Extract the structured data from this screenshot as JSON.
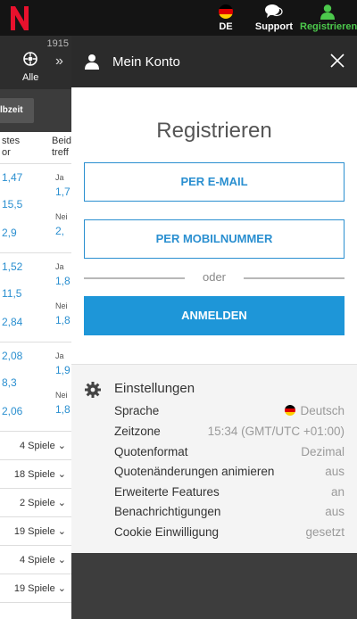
{
  "header": {
    "language_label": "DE",
    "support_label": "Support",
    "register_label": "Registrieren"
  },
  "sport_strip": {
    "count": "1915",
    "label": "Alle"
  },
  "left_list": {
    "halbzeit": "lbzeit",
    "col1_header": [
      "stes",
      "or"
    ],
    "col2_header": [
      "Beid",
      "treff"
    ],
    "blocks": [
      {
        "odds": [
          "1,47",
          "15,5",
          "2,9"
        ],
        "right": [
          {
            "label": "Ja",
            "odd": "1,7"
          },
          {
            "label": "Nei",
            "odd": "2,"
          }
        ]
      },
      {
        "odds": [
          "1,52",
          "11,5",
          "2,84"
        ],
        "right": [
          {
            "label": "Ja",
            "odd": "1,8"
          },
          {
            "label": "Nei",
            "odd": "1,8"
          }
        ]
      },
      {
        "odds": [
          "2,08",
          "8,3",
          "2,06"
        ],
        "right": [
          {
            "label": "Ja",
            "odd": "1,9"
          },
          {
            "label": "Nei",
            "odd": "1,8"
          }
        ]
      }
    ],
    "games": [
      "4 Spiele",
      "18 Spiele",
      "2 Spiele",
      "19 Spiele",
      "4 Spiele",
      "19 Spiele"
    ]
  },
  "modal": {
    "header_title": "Mein Konto",
    "title": "Registrieren",
    "email_button": "PER E-MAIL",
    "mobile_button": "PER MOBILNUMMER",
    "or_text": "oder",
    "login_button": "ANMELDEN",
    "settings": {
      "title": "Einstellungen",
      "rows": [
        {
          "key": "Sprache",
          "value": "Deutsch"
        },
        {
          "key": "Zeitzone",
          "value": "15:34 (GMT/UTC +01:00)"
        },
        {
          "key": "Quotenformat",
          "value": "Dezimal"
        },
        {
          "key": "Quotenänderungen animieren",
          "value": "aus"
        },
        {
          "key": "Erweiterte Features",
          "value": "an"
        },
        {
          "key": "Benachrichtigungen",
          "value": "aus"
        },
        {
          "key": "Cookie Einwilligung",
          "value": "gesetzt"
        }
      ]
    }
  },
  "colors": {
    "accent_blue": "#1e96d8",
    "register_green": "#4cc94c",
    "logo_red": "#e8112d"
  }
}
